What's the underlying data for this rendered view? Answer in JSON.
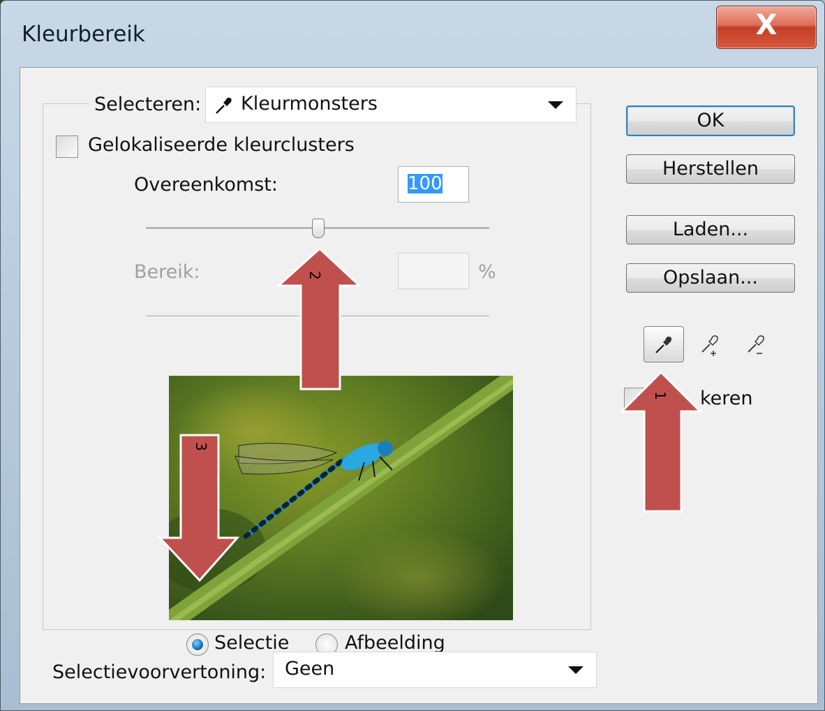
{
  "window": {
    "title": "Kleurbereik",
    "close_glyph": "X"
  },
  "select": {
    "label": "Selecteren:",
    "value": "Kleurmonsters",
    "icon": "eyedropper-icon"
  },
  "localized": {
    "label": "Gelokaliseerde kleurclusters",
    "checked": false
  },
  "fuzziness": {
    "label": "Overeenkomst:",
    "value": "100",
    "slider_fraction": 0.5
  },
  "range": {
    "label": "Bereik:",
    "value": "",
    "unit": "%"
  },
  "preview_options": {
    "selection": "Selectie",
    "image": "Afbeelding",
    "selected": "Selectie"
  },
  "selection_preview": {
    "label": "Selectievoorvertoning:",
    "value": "Geen"
  },
  "buttons": {
    "ok": "OK",
    "reset": "Herstellen",
    "load": "Laden...",
    "save": "Opslaan..."
  },
  "eyedroppers": [
    "eyedropper-icon",
    "eyedropper-plus-icon",
    "eyedropper-minus-icon"
  ],
  "invert": {
    "label": "Omkeren",
    "visible_text": "keren",
    "checked": false
  },
  "annotations": {
    "arrow1": "1",
    "arrow2": "2",
    "arrow3": "3",
    "color": "#c0504d"
  },
  "colors": {
    "title_bar": "#b4c8da",
    "client": "#f0f0f0",
    "selected_text_bg": "#3399ff"
  }
}
